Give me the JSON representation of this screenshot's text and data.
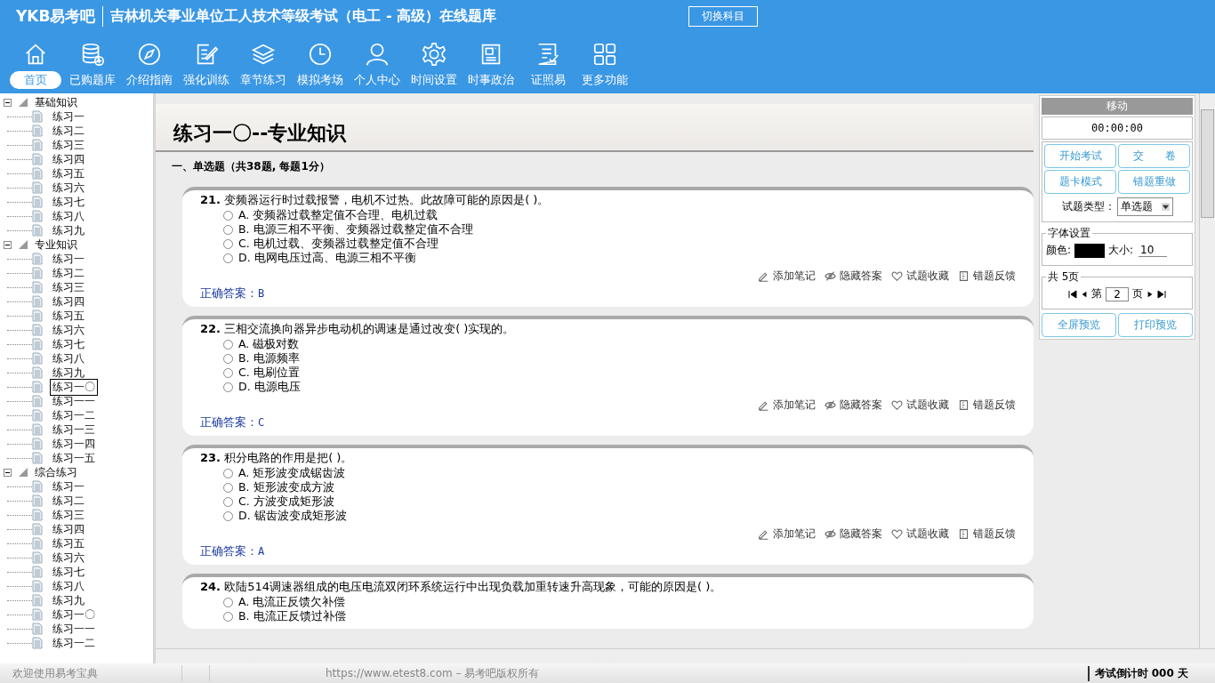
{
  "header": {
    "logo": "YKB易考吧",
    "title": "吉林机关事业单位工人技术等级考试（电工 - 高级）在线题库",
    "switch_button": "切换科目"
  },
  "toolbar": [
    {
      "label": "首页",
      "selected": true
    },
    {
      "label": "已购题库",
      "selected": false
    },
    {
      "label": "介绍指南",
      "selected": false
    },
    {
      "label": "强化训练",
      "selected": false
    },
    {
      "label": "章节练习",
      "selected": false
    },
    {
      "label": "模拟考场",
      "selected": false
    },
    {
      "label": "个人中心",
      "selected": false
    },
    {
      "label": "时间设置",
      "selected": false
    },
    {
      "label": "时事政治",
      "selected": false
    },
    {
      "label": "证照易",
      "selected": false
    },
    {
      "label": "更多功能",
      "selected": false
    }
  ],
  "tree": [
    {
      "label": "基础知识",
      "expanded": true,
      "children": [
        {
          "label": "练习一",
          "selected": false
        },
        {
          "label": "练习二",
          "selected": false
        },
        {
          "label": "练习三",
          "selected": false
        },
        {
          "label": "练习四",
          "selected": false
        },
        {
          "label": "练习五",
          "selected": false
        },
        {
          "label": "练习六",
          "selected": false
        },
        {
          "label": "练习七",
          "selected": false
        },
        {
          "label": "练习八",
          "selected": false
        },
        {
          "label": "练习九",
          "selected": false
        }
      ]
    },
    {
      "label": "专业知识",
      "expanded": true,
      "children": [
        {
          "label": "练习一",
          "selected": false
        },
        {
          "label": "练习二",
          "selected": false
        },
        {
          "label": "练习三",
          "selected": false
        },
        {
          "label": "练习四",
          "selected": false
        },
        {
          "label": "练习五",
          "selected": false
        },
        {
          "label": "练习六",
          "selected": false
        },
        {
          "label": "练习七",
          "selected": false
        },
        {
          "label": "练习八",
          "selected": false
        },
        {
          "label": "练习九",
          "selected": false
        },
        {
          "label": "练习一〇",
          "selected": true
        },
        {
          "label": "练习一一",
          "selected": false
        },
        {
          "label": "练习一二",
          "selected": false
        },
        {
          "label": "练习一三",
          "selected": false
        },
        {
          "label": "练习一四",
          "selected": false
        },
        {
          "label": "练习一五",
          "selected": false
        }
      ]
    },
    {
      "label": "综合练习",
      "expanded": true,
      "children": [
        {
          "label": "练习一",
          "selected": false
        },
        {
          "label": "练习二",
          "selected": false
        },
        {
          "label": "练习三",
          "selected": false
        },
        {
          "label": "练习四",
          "selected": false
        },
        {
          "label": "练习五",
          "selected": false
        },
        {
          "label": "练习六",
          "selected": false
        },
        {
          "label": "练习七",
          "selected": false
        },
        {
          "label": "练习八",
          "selected": false
        },
        {
          "label": "练习九",
          "selected": false
        },
        {
          "label": "练习一〇",
          "selected": false
        },
        {
          "label": "练习一一",
          "selected": false
        },
        {
          "label": "练习一二",
          "selected": false
        }
      ]
    }
  ],
  "page_title": "练习一〇--专业知识",
  "section_heading": "一、单选题（共38题, 每题1分）",
  "questions": [
    {
      "number": "21.",
      "text": "变频器运行时过载报警，电机不过热。此故障可能的原因是( )。",
      "options": [
        {
          "letter": "A.",
          "text": "变频器过载整定值不合理、电机过载",
          "selected": false
        },
        {
          "letter": "B.",
          "text": "电源三相不平衡、变频器过载整定值不合理",
          "selected": false
        },
        {
          "letter": "C.",
          "text": "电机过载、变频器过载整定值不合理",
          "selected": false
        },
        {
          "letter": "D.",
          "text": "电网电压过高、电源三相不平衡",
          "selected": false
        }
      ],
      "answer_label": "正确答案：",
      "answer": "B",
      "actions": [
        {
          "kind": "note",
          "label": "添加笔记"
        },
        {
          "kind": "hide",
          "label": "隐藏答案"
        },
        {
          "kind": "favorite",
          "label": "试题收藏"
        },
        {
          "kind": "feedback",
          "label": "错题反馈"
        }
      ]
    },
    {
      "number": "22.",
      "text": "三相交流换向器异步电动机的调速是通过改变( )实现的。",
      "options": [
        {
          "letter": "A.",
          "text": "磁极对数",
          "selected": false
        },
        {
          "letter": "B.",
          "text": "电源频率",
          "selected": false
        },
        {
          "letter": "C.",
          "text": "电刷位置",
          "selected": false
        },
        {
          "letter": "D.",
          "text": "电源电压",
          "selected": false
        }
      ],
      "answer_label": "正确答案：",
      "answer": "C",
      "actions": [
        {
          "kind": "note",
          "label": "添加笔记"
        },
        {
          "kind": "hide",
          "label": "隐藏答案"
        },
        {
          "kind": "favorite",
          "label": "试题收藏"
        },
        {
          "kind": "feedback",
          "label": "错题反馈"
        }
      ]
    },
    {
      "number": "23.",
      "text": "积分电路的作用是把( )。",
      "options": [
        {
          "letter": "A.",
          "text": "矩形波变成锯齿波",
          "selected": false
        },
        {
          "letter": "B.",
          "text": "矩形波变成方波",
          "selected": false
        },
        {
          "letter": "C.",
          "text": "方波变成矩形波",
          "selected": false
        },
        {
          "letter": "D.",
          "text": "锯齿波变成矩形波",
          "selected": false
        }
      ],
      "answer_label": "正确答案：",
      "answer": "A",
      "actions": [
        {
          "kind": "note",
          "label": "添加笔记"
        },
        {
          "kind": "hide",
          "label": "隐藏答案"
        },
        {
          "kind": "favorite",
          "label": "试题收藏"
        },
        {
          "kind": "feedback",
          "label": "错题反馈"
        }
      ]
    },
    {
      "number": "24.",
      "text": "欧陆514调速器组成的电压电流双闭环系统运行中出现负载加重转速升高现象，可能的原因是( )。",
      "options": [
        {
          "letter": "A.",
          "text": "电流正反馈欠补偿",
          "selected": false
        },
        {
          "letter": "B.",
          "text": "电流正反馈过补偿",
          "selected": false
        }
      ]
    }
  ],
  "panel": {
    "title": "移动",
    "timer": "00:00:00",
    "buttons": [
      "开始考试",
      "交　　卷",
      "题卡模式",
      "错题重做"
    ],
    "type_label": "试题类型：",
    "type_value": "单选题",
    "font_group": "字体设置",
    "color_label": "颜色:",
    "size_label": "大小:",
    "size": "10",
    "pages_group": "共 5页",
    "page_prefix": "第",
    "page": "2",
    "page_suffix": "页",
    "bottom_buttons": [
      "全屏预览",
      "打印预览"
    ]
  },
  "status": {
    "welcome": "欢迎使用易考宝典",
    "copyright": "https://www.etest8.com – 易考吧版权所有",
    "countdown": "考试倒计时 000 天"
  }
}
